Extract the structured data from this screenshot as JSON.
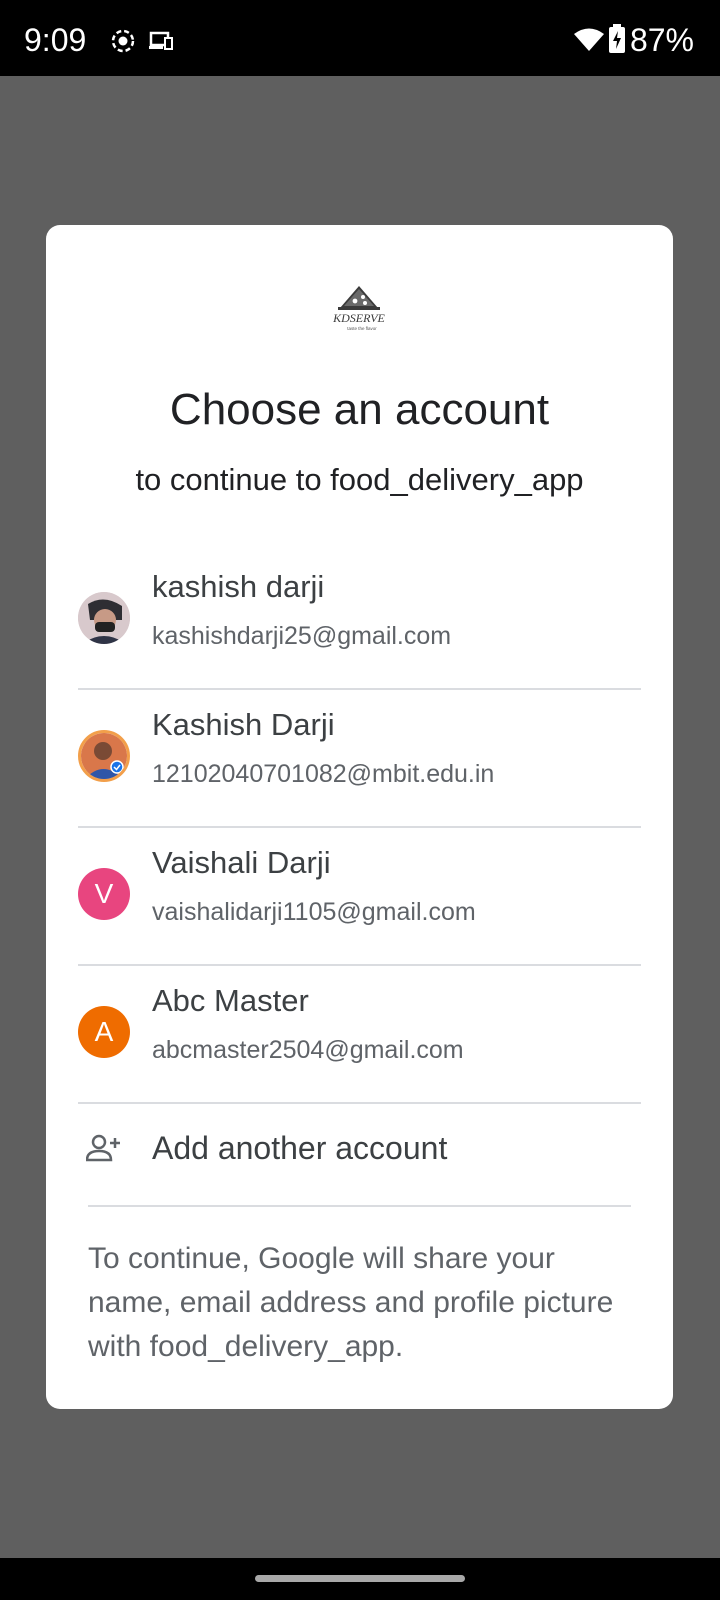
{
  "status_bar": {
    "time": "9:09",
    "battery_percent": "87%",
    "icons": [
      "screen-record-icon",
      "cast-device-icon",
      "wifi-icon",
      "battery-charging-icon"
    ]
  },
  "dialog": {
    "logo_text": "KDSERVE",
    "logo_tagline": "taste the flavor",
    "title": "Choose an account",
    "subtitle": "to continue to food_delivery_app",
    "accounts": [
      {
        "name": "kashish darji",
        "email": "kashishdarji25@gmail.com",
        "avatar": "photo"
      },
      {
        "name": "Kashish Darji",
        "email": "12102040701082@mbit.edu.in",
        "avatar": "photo"
      },
      {
        "name": "Vaishali Darji",
        "email": "vaishalidarji1105@gmail.com",
        "avatar": "V",
        "avatar_color": "#e8457f"
      },
      {
        "name": "Abc Master",
        "email": "abcmaster2504@gmail.com",
        "avatar": "A",
        "avatar_color": "#ef6c00"
      }
    ],
    "add_account_label": "Add another account",
    "footer_text": "To continue, Google will share your name, email address and profile picture with food_delivery_app."
  }
}
